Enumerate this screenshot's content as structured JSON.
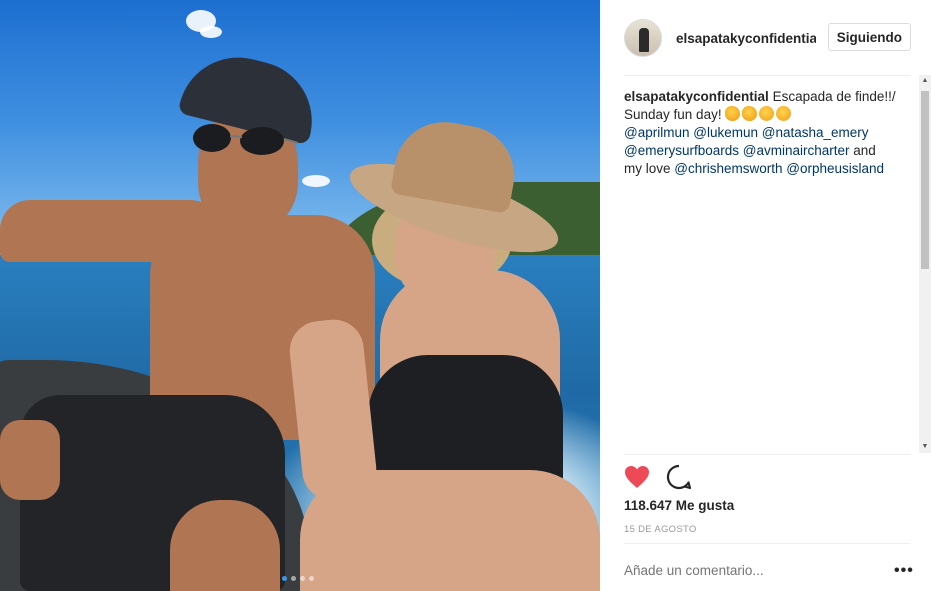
{
  "post": {
    "username": "elsapatakyconfidential",
    "follow_label": "Siguiendo",
    "caption": {
      "owner": "elsapatakyconfidential",
      "text_part1": "Escapada de finde!!/ Sunday fun day!",
      "emojis": [
        "clapping-hands",
        "clapping-hands",
        "kissing-face",
        "kissing-face"
      ],
      "mentions_line1": [
        "@aprilmun",
        "@lukemun",
        "@natasha_emery"
      ],
      "mentions_line2": [
        "@emerysurfboards",
        "@avminaircharter"
      ],
      "and_text": "and",
      "love_text": "my love",
      "mentions_line3": [
        "@chrishemsworth",
        "@orpheusisland"
      ]
    },
    "likes": "118.647 Me gusta",
    "date": "15 DE AGOSTO",
    "comment_placeholder": "Añade un comentario...",
    "more_label": "•••",
    "carousel": {
      "count": 4,
      "active_index": 0
    }
  },
  "colors": {
    "heart": "#ed4956",
    "mention": "#003569",
    "carousel_active": "#3897f0"
  },
  "icons": [
    "heart-icon",
    "comment-icon",
    "more-options-icon"
  ]
}
